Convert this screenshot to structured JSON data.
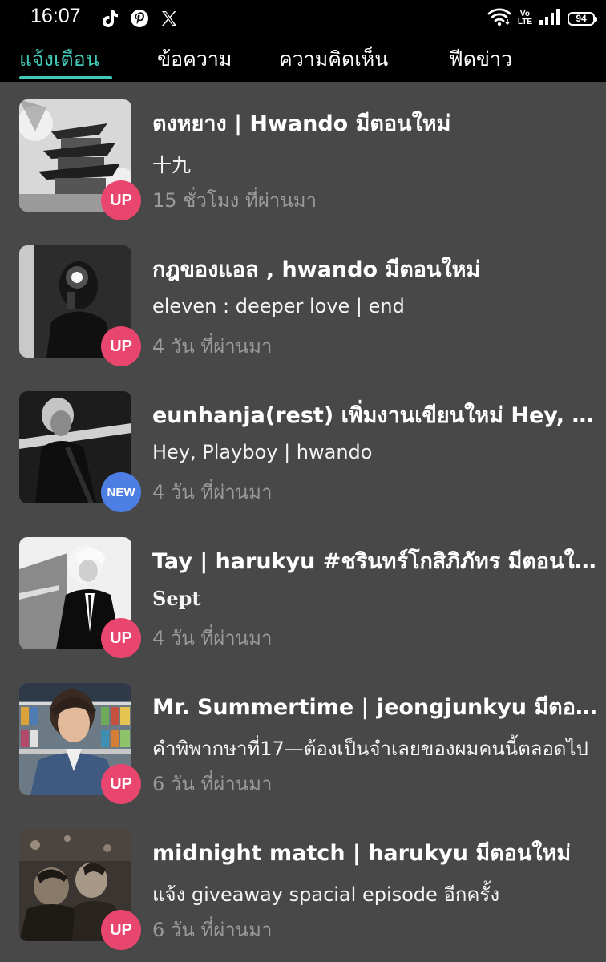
{
  "status_bar": {
    "time": "16:07",
    "app_icons": [
      "tiktok-icon",
      "pinterest-icon",
      "x-icon"
    ],
    "volte_top": "Vo",
    "volte_bottom": "LTE",
    "battery": "94"
  },
  "tabs": [
    {
      "label": "แจ้งเตือน",
      "active": true
    },
    {
      "label": "ข้อความ",
      "active": false
    },
    {
      "label": "ความคิดเห็น",
      "active": false
    },
    {
      "label": "ฟีดข่าว",
      "active": false
    }
  ],
  "colors": {
    "accent": "#41c9b8",
    "background": "#484848",
    "badge_up": "#e8466f",
    "badge_new": "#4d7ee3",
    "time_text": "#9a9a9a"
  },
  "notifications": [
    {
      "title": "ตงหยาง | Hwando  มีตอนใหม่",
      "subtitle": "十九",
      "time": "15 ชั่วโมง ที่ผ่านมา",
      "badge": "UP",
      "thumb": "pagoda-photo"
    },
    {
      "title": "กฎของแอล , hwando มีตอนใหม่",
      "subtitle": "eleven : deeper love | end",
      "time": "4 วัน ที่ผ่านมา",
      "badge": "UP",
      "thumb": "mirror-selfie-photo"
    },
    {
      "title": "eunhanja(rest) เพิ่มงานเขียนใหม่ Hey, Playboy",
      "subtitle": "Hey, Playboy | hwando",
      "time": "4 วัน ที่ผ่านมา",
      "badge": "NEW",
      "thumb": "portrait-photo"
    },
    {
      "title": "Tay | harukyu #ชรินทร์โกสิภิภัทร มีตอนใหม่",
      "subtitle": "Sept",
      "time": "4 วัน ที่ผ่านมา",
      "badge": "UP",
      "thumb": "suit-photo"
    },
    {
      "title": "Mr. Summertime | jeongjunkyu  มีตอนใหม่",
      "subtitle": "คำพิพากษาที่17—ต้องเป็นจำเลยของผมคนนี้ตลอดไป",
      "time": "6 วัน ที่ผ่านมา",
      "badge": "UP",
      "thumb": "store-photo"
    },
    {
      "title": "midnight match | harukyu มีตอนใหม่",
      "subtitle": "แจ้ง giveaway spacial episode อีกครั้ง",
      "time": "6 วัน ที่ผ่านมา",
      "badge": "UP",
      "thumb": "crowd-photo"
    }
  ]
}
